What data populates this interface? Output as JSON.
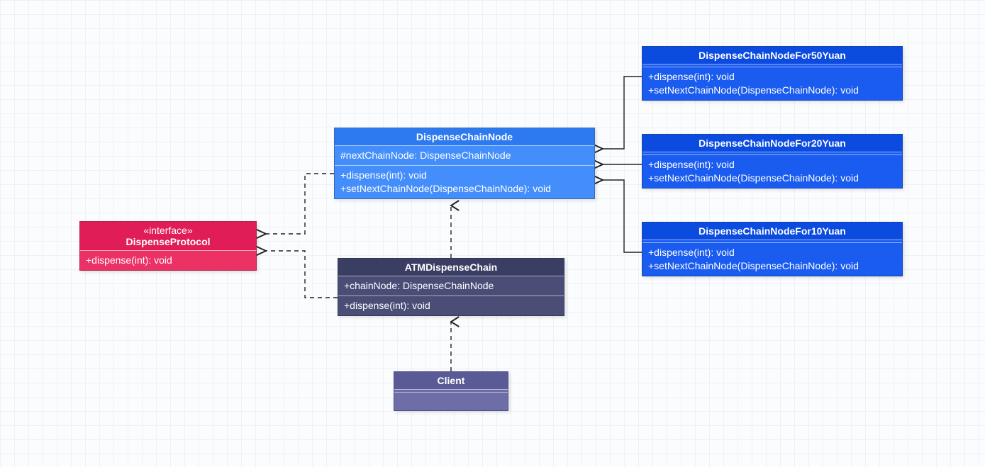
{
  "boxes": {
    "dispenseProtocol": {
      "stereotype": "«interface»",
      "name": "DispenseProtocol",
      "methods": [
        "+dispense(int): void"
      ]
    },
    "dispenseChainNode": {
      "name": "DispenseChainNode",
      "attrs": [
        "#nextChainNode: DispenseChainNode"
      ],
      "methods": [
        "+dispense(int): void",
        "+setNextChainNode(DispenseChainNode): void"
      ]
    },
    "atmDispenseChain": {
      "name": "ATMDispenseChain",
      "attrs": [
        "+chainNode: DispenseChainNode"
      ],
      "methods": [
        "+dispense(int): void"
      ]
    },
    "client": {
      "name": "Client"
    },
    "node50": {
      "name": "DispenseChainNodeFor50Yuan",
      "methods": [
        "+dispense(int): void",
        "+setNextChainNode(DispenseChainNode): void"
      ]
    },
    "node20": {
      "name": "DispenseChainNodeFor20Yuan",
      "methods": [
        "+dispense(int): void",
        "+setNextChainNode(DispenseChainNode): void"
      ]
    },
    "node10": {
      "name": "DispenseChainNodeFor10Yuan",
      "methods": [
        "+dispense(int): void",
        "+setNextChainNode(DispenseChainNode): void"
      ]
    }
  }
}
